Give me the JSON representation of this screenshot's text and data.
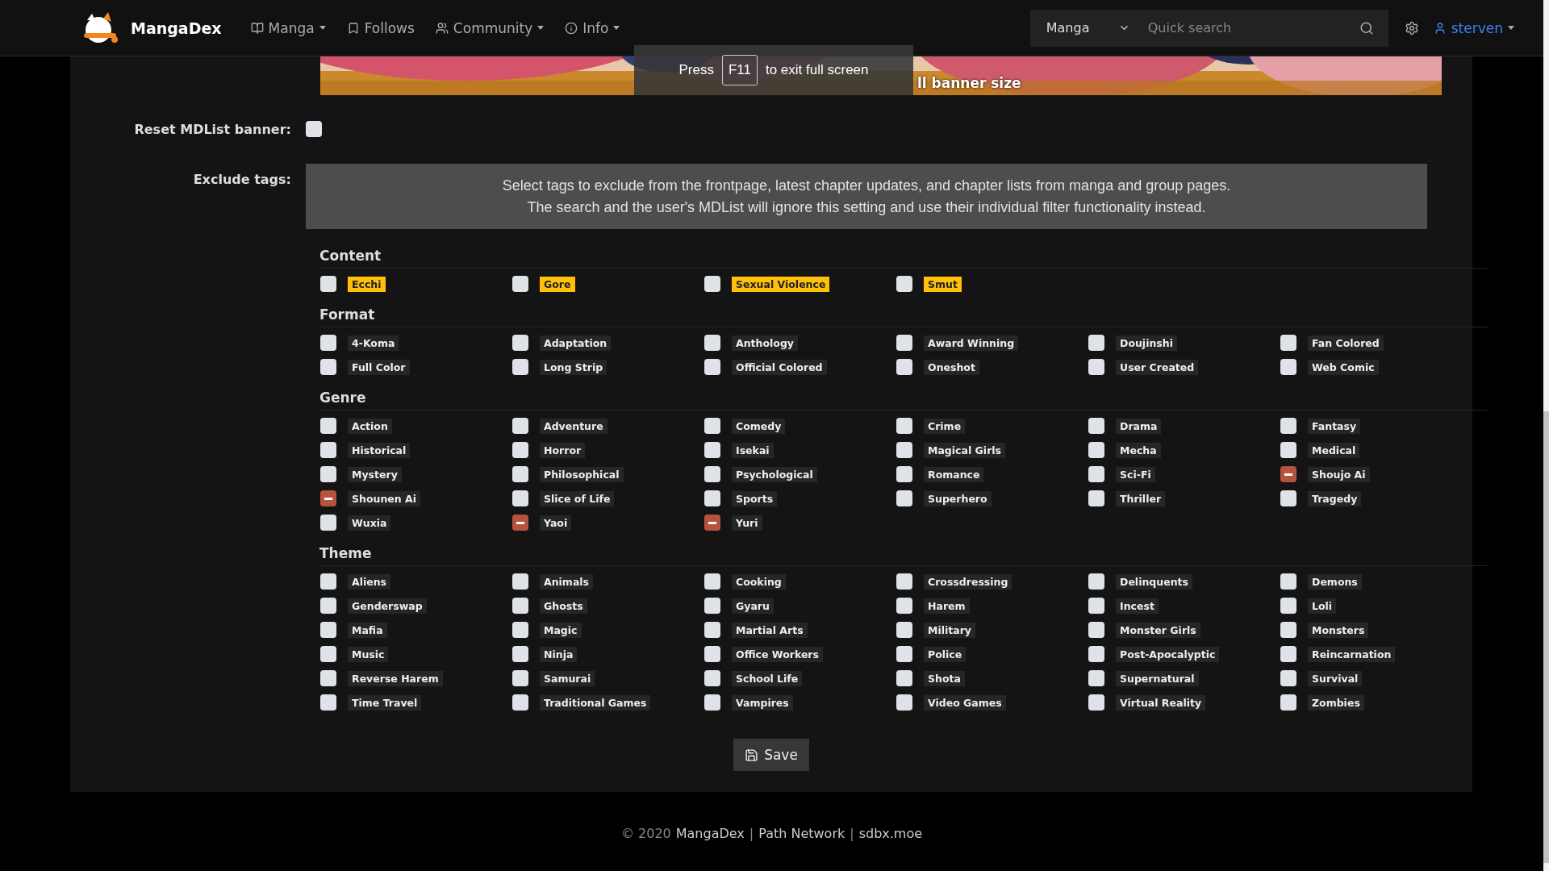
{
  "nav": {
    "brand": "MangaDex",
    "items": [
      {
        "label": "Manga",
        "caret": true
      },
      {
        "label": "Follows",
        "caret": false
      },
      {
        "label": "Community",
        "caret": true
      },
      {
        "label": "Info",
        "caret": true
      }
    ],
    "search": {
      "type": "Manga",
      "placeholder": "Quick search"
    },
    "user": "sterven"
  },
  "fullscreen_notice": {
    "before": "Press",
    "key": "F11",
    "after": "to exit full screen"
  },
  "banner": {
    "link": "ll banner size"
  },
  "reset": {
    "label": "Reset MDList banner:",
    "checked": false
  },
  "exclude": {
    "label": "Exclude tags:",
    "info": [
      "Select tags to exclude from the frontpage, latest chapter updates, and chapter lists from manga and group pages.",
      "The search and the user's MDList will ignore this setting and use their individual filter functionality instead."
    ],
    "sections": [
      {
        "title": "Content",
        "kind": "warning",
        "tags": [
          {
            "label": "Ecchi",
            "excluded": false
          },
          {
            "label": "Gore",
            "excluded": false
          },
          {
            "label": "Sexual Violence",
            "excluded": false
          },
          {
            "label": "Smut",
            "excluded": false
          }
        ]
      },
      {
        "title": "Format",
        "kind": "plain",
        "tags": [
          {
            "label": "4-Koma",
            "excluded": false
          },
          {
            "label": "Adaptation",
            "excluded": false
          },
          {
            "label": "Anthology",
            "excluded": false
          },
          {
            "label": "Award Winning",
            "excluded": false
          },
          {
            "label": "Doujinshi",
            "excluded": false
          },
          {
            "label": "Fan Colored",
            "excluded": false
          },
          {
            "label": "Full Color",
            "excluded": false
          },
          {
            "label": "Long Strip",
            "excluded": false
          },
          {
            "label": "Official Colored",
            "excluded": false
          },
          {
            "label": "Oneshot",
            "excluded": false
          },
          {
            "label": "User Created",
            "excluded": false
          },
          {
            "label": "Web Comic",
            "excluded": false
          }
        ]
      },
      {
        "title": "Genre",
        "kind": "plain",
        "tags": [
          {
            "label": "Action",
            "excluded": false
          },
          {
            "label": "Adventure",
            "excluded": false
          },
          {
            "label": "Comedy",
            "excluded": false
          },
          {
            "label": "Crime",
            "excluded": false
          },
          {
            "label": "Drama",
            "excluded": false
          },
          {
            "label": "Fantasy",
            "excluded": false
          },
          {
            "label": "Historical",
            "excluded": false
          },
          {
            "label": "Horror",
            "excluded": false
          },
          {
            "label": "Isekai",
            "excluded": false
          },
          {
            "label": "Magical Girls",
            "excluded": false
          },
          {
            "label": "Mecha",
            "excluded": false
          },
          {
            "label": "Medical",
            "excluded": false
          },
          {
            "label": "Mystery",
            "excluded": false
          },
          {
            "label": "Philosophical",
            "excluded": false
          },
          {
            "label": "Psychological",
            "excluded": false
          },
          {
            "label": "Romance",
            "excluded": false
          },
          {
            "label": "Sci-Fi",
            "excluded": false
          },
          {
            "label": "Shoujo Ai",
            "excluded": true
          },
          {
            "label": "Shounen Ai",
            "excluded": true
          },
          {
            "label": "Slice of Life",
            "excluded": false
          },
          {
            "label": "Sports",
            "excluded": false
          },
          {
            "label": "Superhero",
            "excluded": false
          },
          {
            "label": "Thriller",
            "excluded": false
          },
          {
            "label": "Tragedy",
            "excluded": false
          },
          {
            "label": "Wuxia",
            "excluded": false
          },
          {
            "label": "Yaoi",
            "excluded": true
          },
          {
            "label": "Yuri",
            "excluded": true
          }
        ]
      },
      {
        "title": "Theme",
        "kind": "plain",
        "tags": [
          {
            "label": "Aliens",
            "excluded": false
          },
          {
            "label": "Animals",
            "excluded": false
          },
          {
            "label": "Cooking",
            "excluded": false
          },
          {
            "label": "Crossdressing",
            "excluded": false
          },
          {
            "label": "Delinquents",
            "excluded": false
          },
          {
            "label": "Demons",
            "excluded": false
          },
          {
            "label": "Genderswap",
            "excluded": false
          },
          {
            "label": "Ghosts",
            "excluded": false
          },
          {
            "label": "Gyaru",
            "excluded": false
          },
          {
            "label": "Harem",
            "excluded": false
          },
          {
            "label": "Incest",
            "excluded": false
          },
          {
            "label": "Loli",
            "excluded": false
          },
          {
            "label": "Mafia",
            "excluded": false
          },
          {
            "label": "Magic",
            "excluded": false
          },
          {
            "label": "Martial Arts",
            "excluded": false
          },
          {
            "label": "Military",
            "excluded": false
          },
          {
            "label": "Monster Girls",
            "excluded": false
          },
          {
            "label": "Monsters",
            "excluded": false
          },
          {
            "label": "Music",
            "excluded": false
          },
          {
            "label": "Ninja",
            "excluded": false
          },
          {
            "label": "Office Workers",
            "excluded": false
          },
          {
            "label": "Police",
            "excluded": false
          },
          {
            "label": "Post-Apocalyptic",
            "excluded": false
          },
          {
            "label": "Reincarnation",
            "excluded": false
          },
          {
            "label": "Reverse Harem",
            "excluded": false
          },
          {
            "label": "Samurai",
            "excluded": false
          },
          {
            "label": "School Life",
            "excluded": false
          },
          {
            "label": "Shota",
            "excluded": false
          },
          {
            "label": "Supernatural",
            "excluded": false
          },
          {
            "label": "Survival",
            "excluded": false
          },
          {
            "label": "Time Travel",
            "excluded": false
          },
          {
            "label": "Traditional Games",
            "excluded": false
          },
          {
            "label": "Vampires",
            "excluded": false
          },
          {
            "label": "Video Games",
            "excluded": false
          },
          {
            "label": "Virtual Reality",
            "excluded": false
          },
          {
            "label": "Zombies",
            "excluded": false
          }
        ]
      }
    ]
  },
  "save": "Save",
  "footer": [
    {
      "text": "© 2020",
      "kind": "plain"
    },
    {
      "text": "MangaDex",
      "kind": "link"
    },
    {
      "text": "|",
      "kind": "plain"
    },
    {
      "text": "Path Network",
      "kind": "link"
    },
    {
      "text": "|",
      "kind": "plain"
    },
    {
      "text": "sdbx.moe",
      "kind": "link"
    }
  ]
}
